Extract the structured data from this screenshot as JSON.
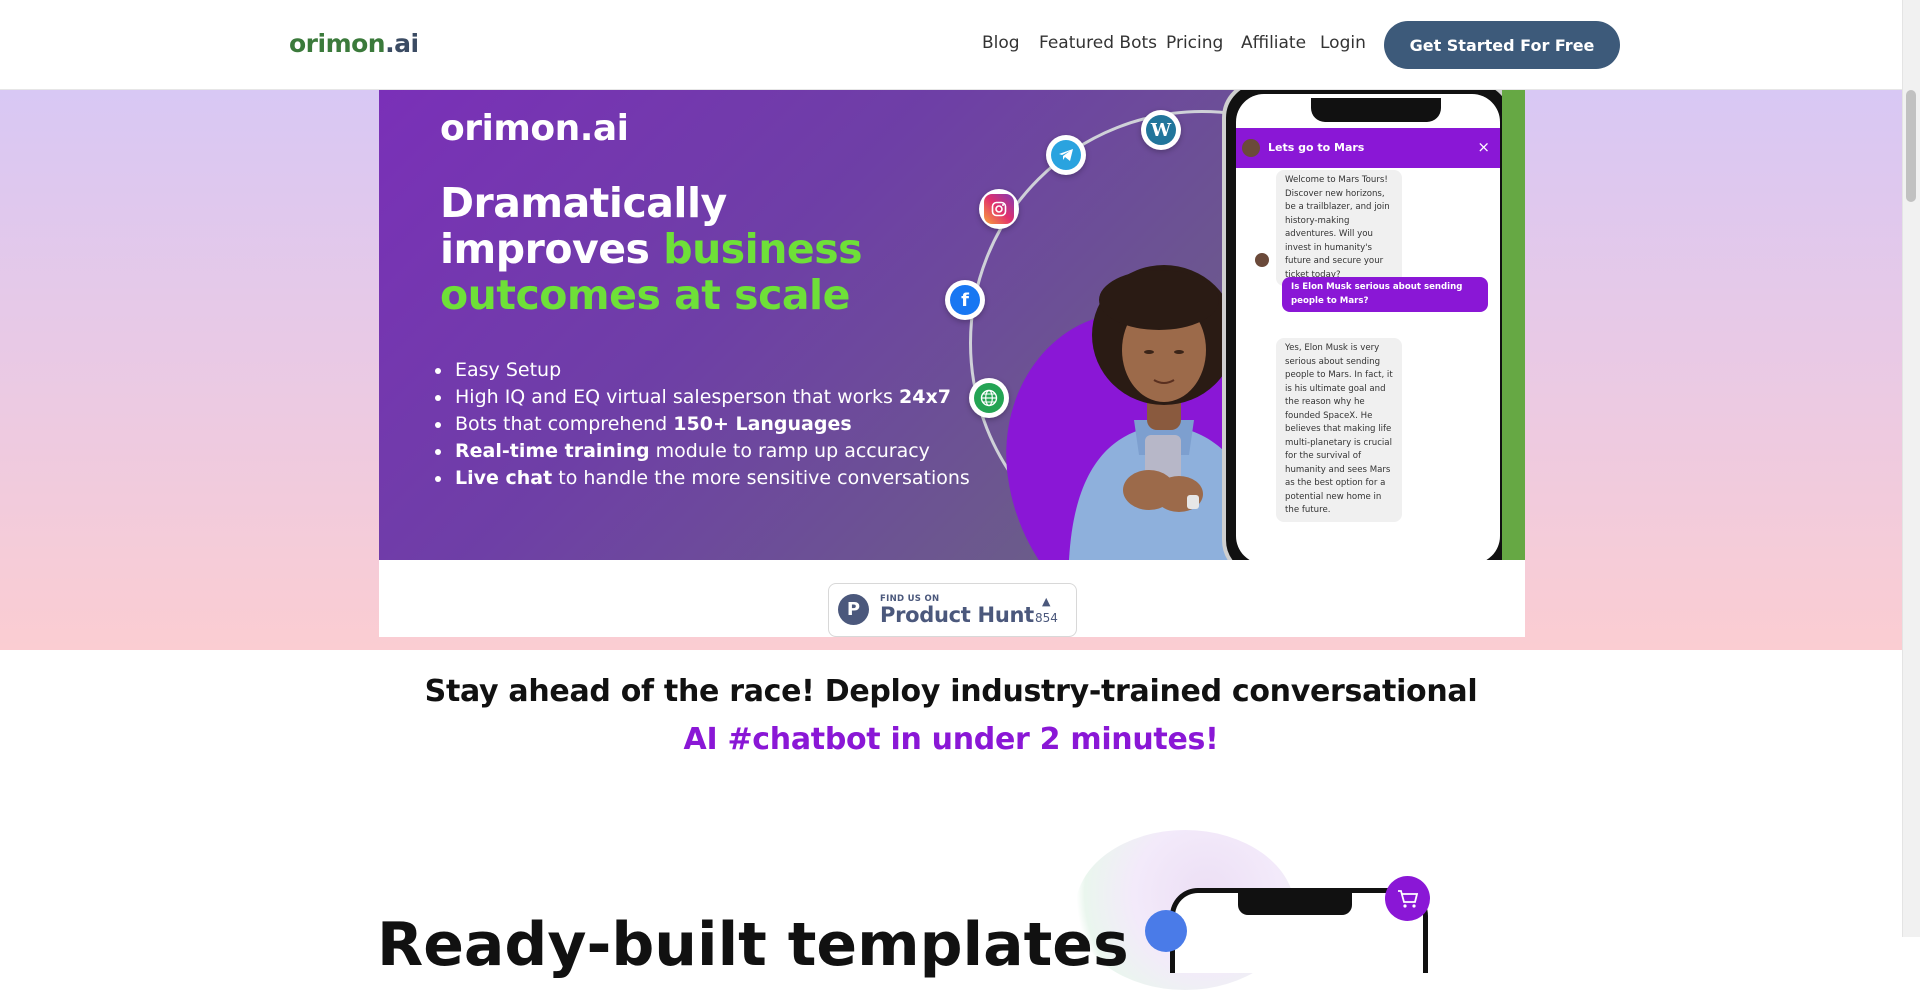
{
  "header": {
    "logo_left": "orimon",
    "logo_right": ".ai",
    "nav": [
      "Blog",
      "Featured Bots",
      "Pricing",
      "Affiliate",
      "Login"
    ],
    "cta": "Get Started For Free"
  },
  "banner": {
    "logo": "orimon.ai",
    "headline_white_1": "Dramatically",
    "headline_white_2": "improves ",
    "headline_green_1": "business",
    "headline_green_2": "outcomes at scale",
    "bullets": [
      {
        "pre": "Easy Setup",
        "bold": "",
        "post": ""
      },
      {
        "pre": "High IQ and EQ virtual salesperson that works ",
        "bold": "24x7",
        "post": ""
      },
      {
        "pre": "Bots that comprehend ",
        "bold": "150+ Languages",
        "post": ""
      },
      {
        "pre": "",
        "bold": "Real-time training",
        "post": " module to ramp up accuracy"
      },
      {
        "pre": "",
        "bold": "Live chat",
        "post": " to handle the more sensitive conversations"
      }
    ],
    "chat": {
      "title": "Lets go to Mars",
      "close": "×",
      "msg1": "Welcome to Mars Tours! Discover new horizons, be a trailblazer, and join history-making adventures. Will you invest in humanity's future and secure your ticket today?",
      "msg2": "Is Elon Musk serious about sending people to Mars?",
      "msg3": "Yes, Elon Musk is very serious about sending people to Mars. In fact, it is his ultimate goal and the reason why he founded SpaceX. He believes that making life multi-planetary is crucial for the survival of humanity and sees Mars as the best option for a potential new home in the future."
    }
  },
  "product_hunt": {
    "small": "FIND US ON",
    "name": "Product Hunt",
    "letter": "P",
    "arrow": "▲",
    "count": "854"
  },
  "tagline": {
    "line1": "Stay ahead of the race! Deploy industry-trained conversational",
    "line2": "AI #chatbot in under 2 minutes!"
  },
  "next_section": {
    "title_partial": "Ready-built templates"
  },
  "colors": {
    "accent_purple": "#8a17d6",
    "cta_blue": "#3d5a7a",
    "green": "#6ee038"
  }
}
